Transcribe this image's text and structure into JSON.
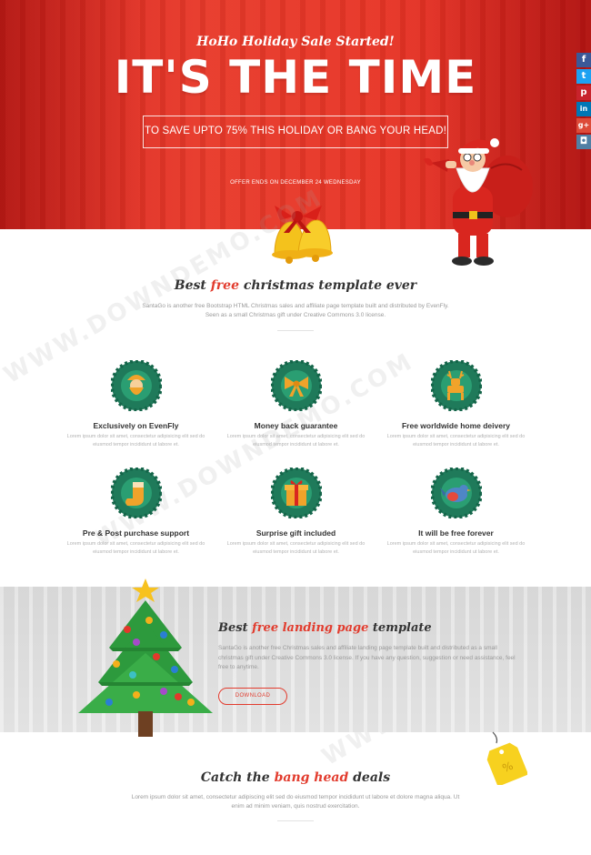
{
  "hero": {
    "kicker": "HoHo Holiday Sale Started!",
    "title": "IT'S THE TIME",
    "subtitle_box": "TO SAVE UPTO 75% THIS HOLIDAY OR BANG YOUR HEAD!",
    "offer": "OFFER ENDS ON DECEMBER 24 WEDNESDAY"
  },
  "social": [
    {
      "icon": "facebook-icon",
      "glyph": "f"
    },
    {
      "icon": "twitter-icon",
      "glyph": "t"
    },
    {
      "icon": "pinterest-icon",
      "glyph": "p"
    },
    {
      "icon": "linkedin-icon",
      "glyph": "in"
    },
    {
      "icon": "googleplus-icon",
      "glyph": "g+"
    },
    {
      "icon": "instagram-icon",
      "glyph": "◘"
    }
  ],
  "section1": {
    "title_pre": "Best ",
    "title_accent": "free",
    "title_post": " christmas template ever",
    "description": "SantaGo is another free Bootstrap HTML Christmas sales and affiliate page template built and distributed by EvenFly. Seen as a small Christmas gift under Creative Commons 3.0 license."
  },
  "features": [
    {
      "title": "Exclusively on EvenFly",
      "desc": "Lorem ipsum dolor sit amet, consectetur adipisicing elit sed do eiusmod tempor incididunt ut labore et.",
      "icon": "santa-face-icon"
    },
    {
      "title": "Money back guarantee",
      "desc": "Lorem ipsum dolor sit amet, consectetur adipisicing elit sed do eiusmod tempor incididunt ut labore et.",
      "icon": "bow-icon"
    },
    {
      "title": "Free worldwide home deivery",
      "desc": "Lorem ipsum dolor sit amet, consectetur adipisicing elit sed do eiusmod tempor incididunt ut labore et.",
      "icon": "reindeer-icon"
    },
    {
      "title": "Pre & Post purchase support",
      "desc": "Lorem ipsum dolor sit amet, consectetur adipisicing elit sed do eiusmod tempor incididunt ut labore et.",
      "icon": "stocking-icon"
    },
    {
      "title": "Surprise gift included",
      "desc": "Lorem ipsum dolor sit amet, consectetur adipisicing elit sed do eiusmod tempor incididunt ut labore et.",
      "icon": "gift-icon"
    },
    {
      "title": "It will be free forever",
      "desc": "Lorem ipsum dolor sit amet, consectetur adipisicing elit sed do eiusmod tempor incididunt ut labore et.",
      "icon": "bird-icon"
    }
  ],
  "section2": {
    "title_pre": "Best ",
    "title_accent": "free landing page",
    "title_post": " template",
    "description": "SantaGo is another free Christmas sales and affiliate landing page template built and distributed as a small christmas gift under Creative Commons 3.0 license. If you have any question, suggestion or need assistance, feel free to anytime.",
    "button": "DOWNLOAD"
  },
  "section3": {
    "title_pre": "Catch the ",
    "title_accent": "bang head",
    "title_post": " deals",
    "description": "Lorem ipsum dolor sit amet, consectetur adipiscing elit sed do eiusmod tempor incididunt ut labore et dolore magna aliqua. Ut enim ad minim veniam, quis nostrud exercitation.",
    "tag_text": "%"
  },
  "watermark": "WWW.DOWNDEMO.COM",
  "colors": {
    "hero_red": "#e23a2a",
    "accent": "#e23c2e",
    "wreath_green": "#1f7a5a",
    "icon_orange": "#f0a32a"
  }
}
